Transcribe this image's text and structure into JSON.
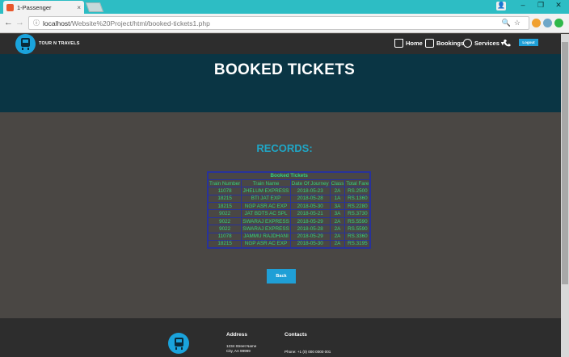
{
  "browser": {
    "tab_title": "1-Passenger",
    "tab_close": "×",
    "url_host": "localhost",
    "url_path": "/Website%20Project/html/booked-tickets1.php",
    "back": "←",
    "forward": "→",
    "reload": "C",
    "info": "ⓘ",
    "omni_icons": "🔍☆",
    "win_minimize": "–",
    "win_maximize": "❐",
    "win_close": "✕",
    "user_icon": "👤"
  },
  "header": {
    "brand": "TOUR N TRAVELS",
    "nav": [
      {
        "label": "Home"
      },
      {
        "label": "Bookings"
      },
      {
        "label": "Services ▾"
      }
    ],
    "login": "Logout"
  },
  "hero": {
    "title": "BOOKED TICKETS"
  },
  "records": {
    "title": "RECORDS:",
    "caption": "Booked Tickets",
    "columns": [
      "Train Number",
      "Train Name",
      "Date Of Journey",
      "Class",
      "Total Fare"
    ],
    "rows": [
      [
        "11078",
        "JHELUM EXPRESS",
        "2018-05-23",
        "2A",
        "RS.2500"
      ],
      [
        "18215",
        "BTI JAT EXP",
        "2018-05-28",
        "1A",
        "RS.1360"
      ],
      [
        "18215",
        "NGP ASR AC EXP",
        "2018-05-30",
        "3A",
        "RS.2280"
      ],
      [
        "9022",
        "JAT BDTS AC SPL",
        "2018-05-21",
        "3A",
        "RS.3730"
      ],
      [
        "9022",
        "SWARAJ EXPRESS",
        "2018-05-29",
        "2A",
        "RS.5590"
      ],
      [
        "9022",
        "SWARAJ EXPRESS",
        "2018-05-28",
        "2A",
        "RS.5590"
      ],
      [
        "11078",
        "JAMMU RAJDHANI",
        "2018-05-29",
        "2A",
        "RS.3360"
      ],
      [
        "18215",
        "NGP ASR AC EXP",
        "2018-05-30",
        "2A",
        "RS.3195"
      ]
    ],
    "back_button": "Back"
  },
  "footer": {
    "address_head": "Address",
    "address_line1": "1234 Street Name",
    "address_line2": "City, AA 99999",
    "contacts_head": "Contacts",
    "phone": "Phone: +1 (0) 000 0000 001"
  },
  "colors": {
    "accent": "#1f9fd6",
    "records_title": "#1fa7c7",
    "table_text": "#35d27c",
    "table_border": "#28329a",
    "hero_bg": "#0a3544",
    "page_bg": "#4a4744",
    "chrome_teal": "#2dbdc4"
  }
}
